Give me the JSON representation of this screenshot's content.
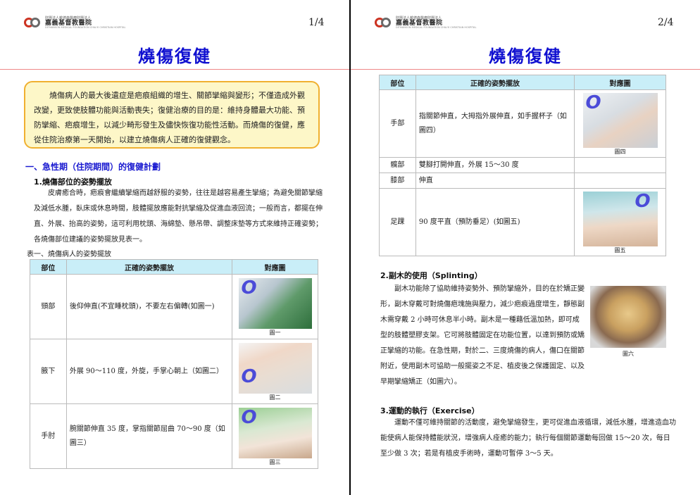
{
  "header": {
    "logo_small": "財團法人戴德森醫療財團法人",
    "logo_big": "嘉義基督教醫院",
    "logo_sub": "DITMANSON MEDICAL FOUNDATION CHIA-YI CHRISTIAN HOSPITAL"
  },
  "page1": {
    "page_number": "1/4",
    "title": "燒傷復健",
    "intro": "燒傷病人的最大後遺症是疤痕組織的增生、關節攣縮與變形；不僅造成外觀改變，更致使肢體功能與活動喪失；復健治療的目的是：維持身體最大功能、預防攣縮、疤痕增生，以減少畸形發生及儘快恢復功能性活動。而燒傷的復健，應從住院治療第一天開始，以建立燒傷病人正確的復健觀念。",
    "section_heading": "一、急性期（住院期間）的復健計劃",
    "sub_heading": "1.燒傷部位的姿勢擺放",
    "paragraph": "皮膚癒合時，疤痕會繼續攣縮而越舒服的姿勢，往往是越容易產生攣縮；為避免關節攣縮及減低水腫，臥床或休息時間，肢體擺放應能對抗攣縮及促進血液回流；一般而言，都擺在伸直、外展、抬高的姿勢，這可利用枕頭、海綿墊、懸吊帶、調整床墊等方式來維持正確姿勢；各燒傷部位建議的姿勢擺放見表一。",
    "table_caption": "表一、燒傷病人的姿勢擺放",
    "table_headers": [
      "部位",
      "正確的姿勢擺放",
      "對應圖"
    ],
    "rows": [
      {
        "part": "頸部",
        "desc": "後仰伸直(不宜睡枕頭)，不要左右偏轉(如圖一)",
        "fig": "圖一"
      },
      {
        "part": "腋下",
        "desc": "外展 90～110 度，外旋，手掌心朝上（如圖二）",
        "fig": "圖二"
      },
      {
        "part": "手肘",
        "desc": "腕關節伸直 35 度，掌指關節屈曲 70～90 度（如圖三）",
        "fig": "圖三"
      }
    ]
  },
  "page2": {
    "page_number": "2/4",
    "title": "燒傷復健",
    "table_headers": [
      "部位",
      "正確的姿勢擺放",
      "對應圖"
    ],
    "rows": [
      {
        "part": "手部",
        "desc": "指關節伸直，大拇指外展伸直，如手握杯子（如圖四）",
        "fig": "圖四"
      },
      {
        "part": "髖部",
        "desc": "雙腳打開伸直，外展 15～30 度",
        "fig": ""
      },
      {
        "part": "膝部",
        "desc": "伸直",
        "fig": ""
      },
      {
        "part": "足踝",
        "desc": "90 度平直（預防垂足）(如圖五)",
        "fig": "圖五"
      }
    ],
    "splint_heading": "2.副木的使用（Splinting）",
    "splint_paragraph": "副木功能除了協助維持姿勢外、預防攣縮外，目的在於矯正變形，副木穿戴可對燒傷疤塊施與壓力，減少疤痕過度增生，靜態副木需穿戴 2 小時可休息半小時。副木是一種藉低溫加熱，即可成型的肢體塑膠支架。它可將肢體固定在功能位置，以達到預防或矯正攣縮的功能。在急性期，對於二、三度燒傷的病人，傷口在關節附近，使用副木可協助一般擺姿之不足、植皮後之保護固定、以及早期攣縮矯正（如圖六）。",
    "fig6_label": "圖六",
    "exercise_heading": "3.運動的執行（Exercise）",
    "exercise_paragraph": "運動不僅可維持關節的活動度，避免攣縮發生，更可促進血液循環，減低水腫，增進造血功能使病人能保持體能狀況，增強病人痊癒的能力；執行每個關節運動每回做 15～20 次，每日至少做 3 次；若是有植皮手術時，運動可暫停 3～5 天。"
  },
  "colors": {
    "title": "#1010d0",
    "table_header_bg": "#c9eef8",
    "intro_bg": "#fdf7c8",
    "intro_border": "#f0b030"
  }
}
